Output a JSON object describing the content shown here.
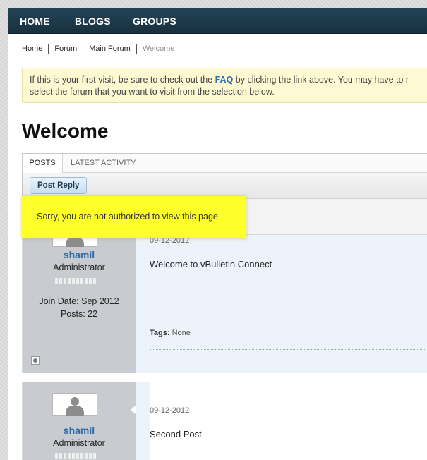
{
  "navbar": {
    "items": [
      {
        "label": "HOME"
      },
      {
        "label": "BLOGS"
      },
      {
        "label": "GROUPS"
      }
    ]
  },
  "breadcrumb": {
    "items": [
      "Home",
      "Forum",
      "Main Forum",
      "Welcome"
    ]
  },
  "notice": {
    "text_before": "If this is your first visit, be sure to check out the ",
    "faq": "FAQ",
    "text_after": " by clicking the link above. You may have to r",
    "line2": "select the forum that you want to visit from the selection below."
  },
  "page": {
    "title": "Welcome"
  },
  "tabs": {
    "posts": "POSTS",
    "latest": "LATEST ACTIVITY"
  },
  "toolbar": {
    "post_reply": "Post Reply"
  },
  "error": {
    "message": "Sorry, you are not authorized to view this page"
  },
  "posts": [
    {
      "username": "shamil",
      "usertitle": "Administrator",
      "join_date": "Join Date: Sep 2012",
      "post_count": "Posts: 22",
      "date": "09-12-2012",
      "text": "Welcome to vBulletin Connect",
      "tags_label": "Tags:",
      "tags_value": "None"
    },
    {
      "username": "shamil",
      "usertitle": "Administrator",
      "date": "09-12-2012",
      "text": "Second Post."
    }
  ],
  "colors": {
    "navbar": "#1f3d4f",
    "link": "#2e6aa3",
    "highlight": "#ffff29",
    "notice_bg": "#fdf9d2"
  },
  "icons": {
    "avatar": "user-silhouette-icon",
    "status": "offline-status-icon"
  }
}
